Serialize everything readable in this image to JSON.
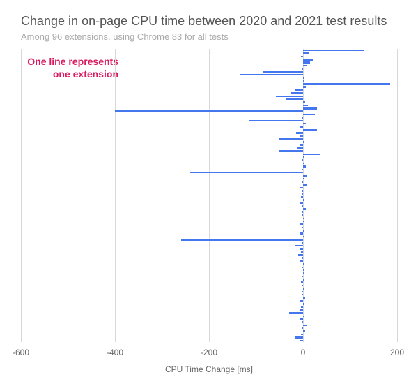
{
  "chart_data": {
    "type": "bar",
    "title": "Change in on-page CPU time between 2020 and 2021 test results",
    "subtitle": "Among 96 extensions, using Chrome 83 for all tests",
    "annotation": "One line represents\none extension",
    "xlabel": "CPU Time Change [ms]",
    "ylabel": "",
    "x_ticks": [
      -600,
      -400,
      -200,
      0,
      200
    ],
    "xlim": [
      -600,
      200
    ],
    "values": [
      130,
      12,
      -5,
      20,
      15,
      8,
      -2,
      -85,
      -135,
      3,
      2,
      185,
      6,
      -18,
      -26,
      -58,
      -35,
      4,
      10,
      30,
      -400,
      25,
      -3,
      -115,
      6,
      -8,
      30,
      -15,
      -6,
      -50,
      2,
      -6,
      -14,
      -50,
      36,
      3,
      -3,
      0,
      6,
      -3,
      -240,
      8,
      3,
      -2,
      8,
      -6,
      -3,
      -2,
      -4,
      2,
      -8,
      -2,
      6,
      -3,
      -2,
      0,
      3,
      -8,
      -2,
      3,
      -6,
      0,
      -260,
      -2,
      -18,
      -6,
      -4,
      -10,
      -2,
      -6,
      3,
      -2,
      2,
      0,
      -3,
      2,
      -4,
      -3,
      0,
      -2,
      -3,
      4,
      -8,
      0,
      -4,
      -6,
      -30,
      3,
      -8,
      -3,
      8,
      -2,
      4,
      -4,
      -18,
      -6
    ]
  }
}
